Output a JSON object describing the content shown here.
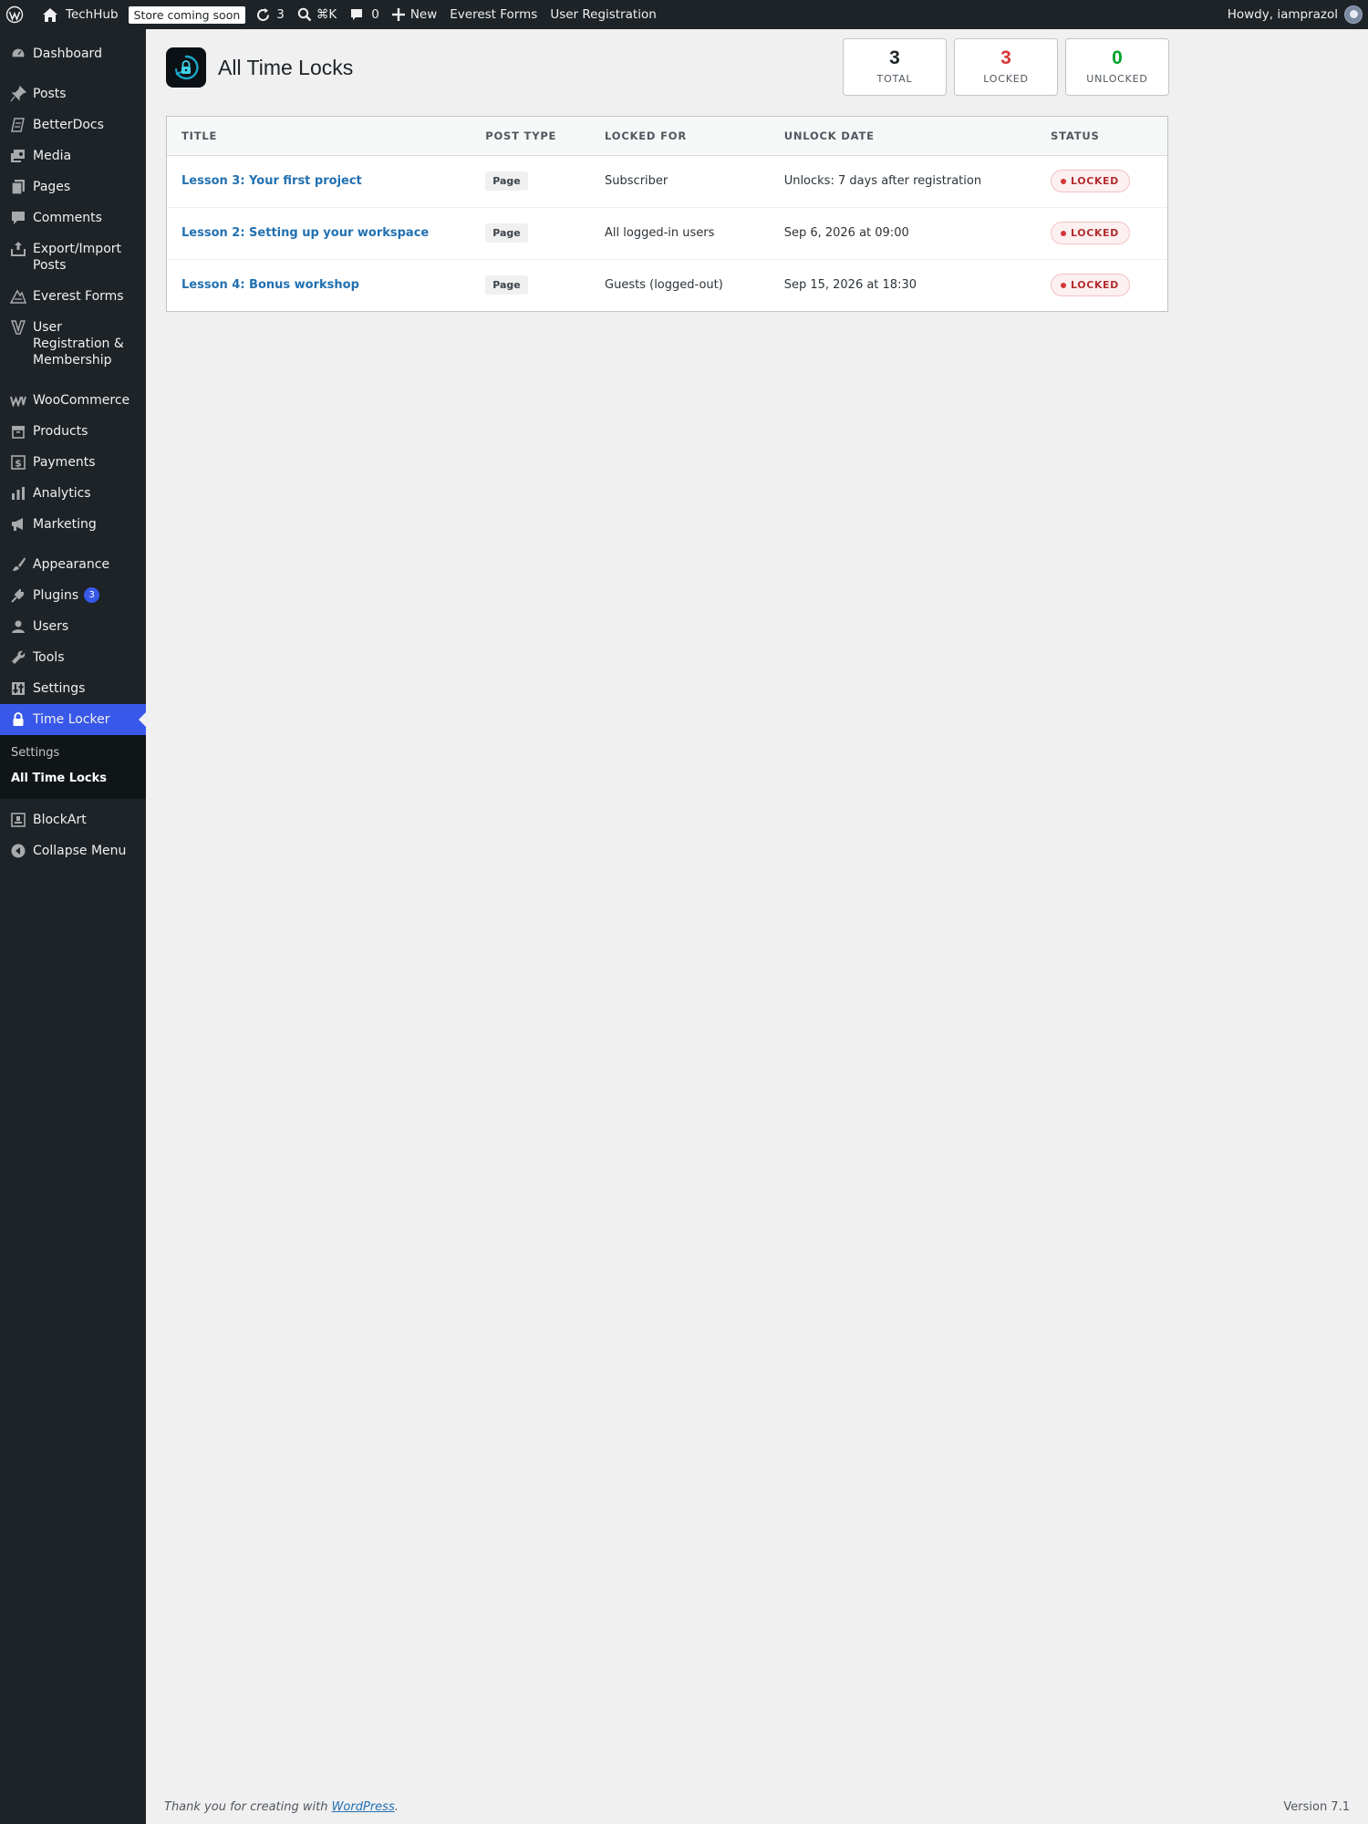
{
  "adminbar": {
    "site_name": "TechHub",
    "store_badge": "Store coming soon",
    "updates_count": "3",
    "search_shortcut": "⌘K",
    "comments_count": "0",
    "new_label": "New",
    "everest_forms": "Everest Forms",
    "user_registration": "User Registration",
    "howdy": "Howdy, iamprazol"
  },
  "sidebar": {
    "items": [
      {
        "label": "Dashboard",
        "icon": "dashboard-icon"
      },
      {
        "label": "Posts",
        "icon": "pin-icon"
      },
      {
        "label": "BetterDocs",
        "icon": "docs-icon"
      },
      {
        "label": "Media",
        "icon": "media-icon"
      },
      {
        "label": "Pages",
        "icon": "pages-icon"
      },
      {
        "label": "Comments",
        "icon": "comment-icon"
      },
      {
        "label": "Export/Import Posts",
        "icon": "export-icon"
      },
      {
        "label": "Everest Forms",
        "icon": "everest-forms-icon"
      },
      {
        "label": "User Registration & Membership",
        "icon": "user-registration-icon"
      },
      {
        "label": "WooCommerce",
        "icon": "woocommerce-icon"
      },
      {
        "label": "Products",
        "icon": "products-icon"
      },
      {
        "label": "Payments",
        "icon": "payments-icon"
      },
      {
        "label": "Analytics",
        "icon": "analytics-icon"
      },
      {
        "label": "Marketing",
        "icon": "megaphone-icon"
      },
      {
        "label": "Appearance",
        "icon": "brush-icon"
      },
      {
        "label": "Plugins",
        "icon": "plugin-icon",
        "badge": "3"
      },
      {
        "label": "Users",
        "icon": "user-icon"
      },
      {
        "label": "Tools",
        "icon": "wrench-icon"
      },
      {
        "label": "Settings",
        "icon": "settings-icon"
      },
      {
        "label": "Time Locker",
        "icon": "lock-icon"
      },
      {
        "label": "BlockArt",
        "icon": "blockart-icon"
      },
      {
        "label": "Collapse Menu",
        "icon": "collapse-icon"
      }
    ],
    "submenu": [
      {
        "label": "Settings"
      },
      {
        "label": "All Time Locks"
      }
    ]
  },
  "page": {
    "title": "All Time Locks"
  },
  "stats": [
    {
      "value": "3",
      "label": "TOTAL",
      "color": "#1d2327"
    },
    {
      "value": "3",
      "label": "LOCKED",
      "color": "#d63638"
    },
    {
      "value": "0",
      "label": "UNLOCKED",
      "color": "#00a32a"
    }
  ],
  "table": {
    "headers": [
      "TITLE",
      "POST TYPE",
      "LOCKED FOR",
      "UNLOCK DATE",
      "STATUS"
    ],
    "rows": [
      {
        "title": "Lesson 3: Your first project",
        "post_type": "Page",
        "locked_for": "Subscriber",
        "unlock_date": "Unlocks: 7 days after registration",
        "status": "LOCKED"
      },
      {
        "title": "Lesson 2: Setting up your workspace",
        "post_type": "Page",
        "locked_for": "All logged-in users",
        "unlock_date": "Sep 6, 2026 at 09:00",
        "status": "LOCKED"
      },
      {
        "title": "Lesson 4: Bonus workshop",
        "post_type": "Page",
        "locked_for": "Guests (logged-out)",
        "unlock_date": "Sep 15, 2026 at 18:30",
        "status": "LOCKED"
      }
    ]
  },
  "footer": {
    "thanks_prefix": "Thank you for creating with ",
    "wordpress_link": "WordPress",
    "thanks_suffix": ".",
    "version": "Version 7.1"
  },
  "colors": {
    "accent": "#3858e9",
    "link": "#2271b1",
    "admin_dark": "#1d2327"
  }
}
